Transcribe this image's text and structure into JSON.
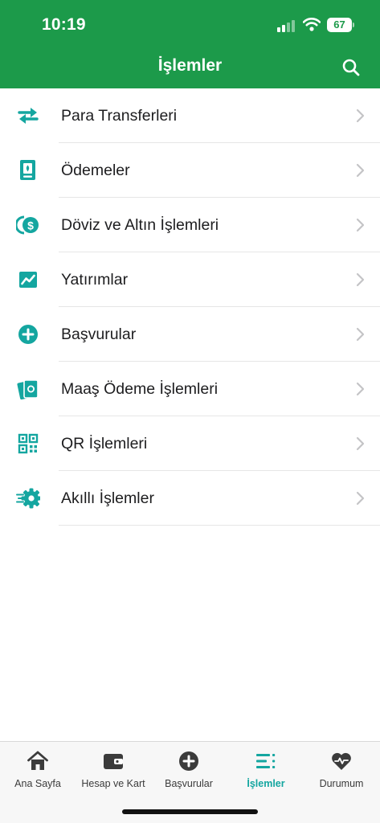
{
  "status_bar": {
    "time": "10:19",
    "battery": "67"
  },
  "header": {
    "title": "İşlemler",
    "search_icon": "search-icon"
  },
  "colors": {
    "header_green": "#1c9a4a",
    "teal_accent": "#14a6a0",
    "chevron": "#c4c4c6"
  },
  "menu": {
    "items": [
      {
        "label": "Para Transferleri",
        "icon": "transfer-arrows-icon"
      },
      {
        "label": "Ödemeler",
        "icon": "receipt-icon"
      },
      {
        "label": "Döviz ve Altın İşlemleri",
        "icon": "currency-coins-icon"
      },
      {
        "label": "Yatırımlar",
        "icon": "chart-trend-icon"
      },
      {
        "label": "Başvurular",
        "icon": "plus-circle-icon"
      },
      {
        "label": "Maaş Ödeme İşlemleri",
        "icon": "salary-cards-icon"
      },
      {
        "label": "QR İşlemleri",
        "icon": "qr-code-icon"
      },
      {
        "label": "Akıllı İşlemler",
        "icon": "smart-gear-icon"
      }
    ]
  },
  "tab_bar": {
    "active": "İşlemler",
    "tabs": [
      {
        "label": "Ana Sayfa",
        "icon": "home-icon"
      },
      {
        "label": "Hesap ve Kart",
        "icon": "wallet-icon"
      },
      {
        "label": "Başvurular",
        "icon": "plus-circle-icon"
      },
      {
        "label": "İşlemler",
        "icon": "list-icon"
      },
      {
        "label": "Durumum",
        "icon": "heart-pulse-icon"
      }
    ]
  }
}
